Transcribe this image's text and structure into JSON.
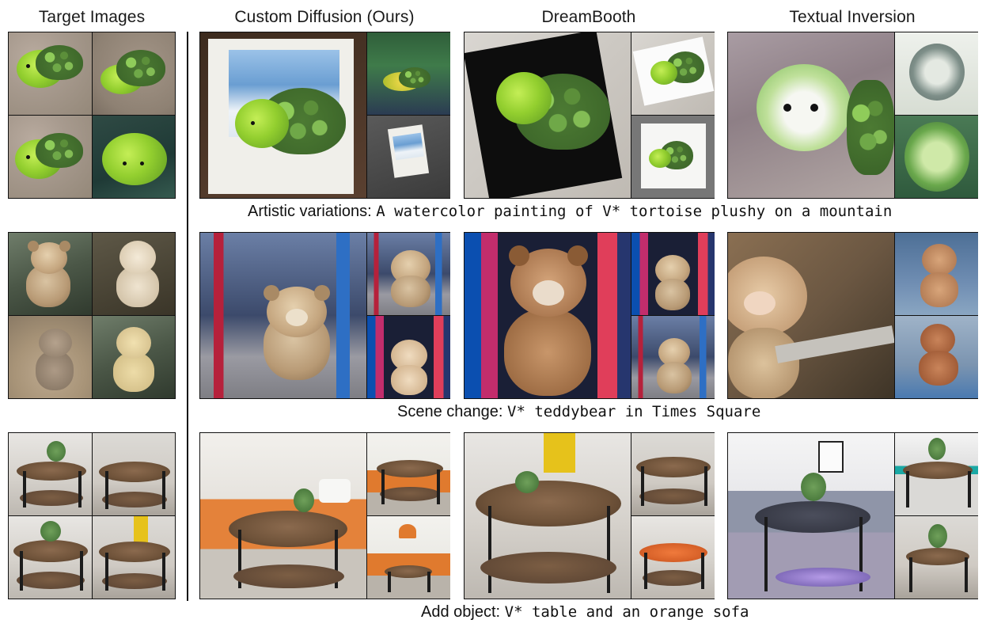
{
  "headers": {
    "target": "Target Images",
    "custom": "Custom Diffusion (Ours)",
    "dreambooth": "DreamBooth",
    "textual": "Textual Inversion"
  },
  "captions": [
    {
      "label": "Artistic variations",
      "sep": ": ",
      "prompt": "A watercolor painting of V* tortoise plushy on a mountain"
    },
    {
      "label": "Scene change",
      "sep": ": ",
      "prompt": "V* teddybear in Times Square"
    },
    {
      "label": "Add object",
      "sep": ": ",
      "prompt": "V* table and an orange sofa"
    }
  ],
  "colors": {
    "divider": "#111111",
    "border": "#111111",
    "turtle_green": "#93cf2f",
    "teddy_brown": "#b89a75",
    "sofa_orange": "#e07a2e"
  }
}
